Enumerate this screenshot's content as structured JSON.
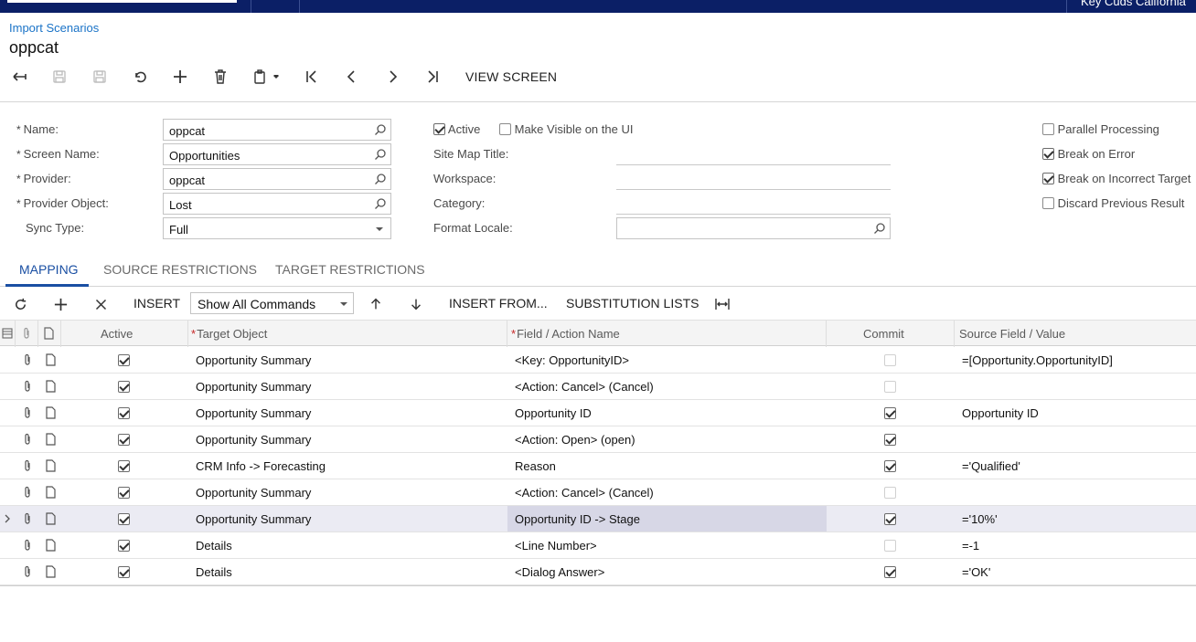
{
  "topbar": {
    "company": "Key Cuds California"
  },
  "breadcrumb": "Import Scenarios",
  "page_title": "oppcat",
  "toolbar": {
    "view_screen": "VIEW SCREEN",
    "icons": [
      "back-icon",
      "save-close-icon",
      "save-icon",
      "undo-icon",
      "add-icon",
      "delete-icon",
      "clipboard-icon",
      "first-icon",
      "previous-icon",
      "next-icon",
      "last-icon"
    ]
  },
  "form": {
    "name_label": "Name:",
    "name_value": "oppcat",
    "screen_name_label": "Screen Name:",
    "screen_name_value": "Opportunities",
    "provider_label": "Provider:",
    "provider_value": "oppcat",
    "provider_object_label": "Provider Object:",
    "provider_object_value": "Lost",
    "sync_type_label": "Sync Type:",
    "sync_type_value": "Full",
    "active_label": "Active",
    "active_checked": true,
    "make_visible_label": "Make Visible on the UI",
    "make_visible_checked": false,
    "site_map_title_label": "Site Map Title:",
    "workspace_label": "Workspace:",
    "category_label": "Category:",
    "format_locale_label": "Format Locale:",
    "parallel_processing_label": "Parallel Processing",
    "parallel_processing_checked": false,
    "break_on_error_label": "Break on Error",
    "break_on_error_checked": true,
    "break_on_incorrect_target_label": "Break on Incorrect Target",
    "break_on_incorrect_target_checked": true,
    "discard_previous_result_label": "Discard Previous Result",
    "discard_previous_result_checked": false
  },
  "tabs": [
    {
      "label": "MAPPING",
      "active": true
    },
    {
      "label": "SOURCE RESTRICTIONS",
      "active": false
    },
    {
      "label": "TARGET RESTRICTIONS",
      "active": false
    }
  ],
  "grid_toolbar": {
    "insert": "INSERT",
    "command_filter": "Show All Commands",
    "insert_from": "INSERT FROM...",
    "substitution_lists": "SUBSTITUTION LISTS"
  },
  "grid": {
    "columns": {
      "active": "Active",
      "target_object": "Target Object",
      "field_action_name": "Field / Action Name",
      "commit": "Commit",
      "source_field_value": "Source Field / Value"
    },
    "rows": [
      {
        "active": true,
        "target_object": "Opportunity Summary",
        "field": "<Key: OpportunityID>",
        "commit": false,
        "source": "=[Opportunity.OpportunityID]"
      },
      {
        "active": true,
        "target_object": "Opportunity Summary",
        "field": "<Action: Cancel> (Cancel)",
        "commit": false,
        "source": ""
      },
      {
        "active": true,
        "target_object": "Opportunity Summary",
        "field": "Opportunity ID",
        "commit": true,
        "source": "Opportunity ID"
      },
      {
        "active": true,
        "target_object": "Opportunity Summary",
        "field": "<Action: Open> (open)",
        "commit": true,
        "source": ""
      },
      {
        "active": true,
        "target_object": "CRM Info -> Forecasting",
        "field": "Reason",
        "commit": true,
        "source": "='Qualified'"
      },
      {
        "active": true,
        "target_object": "Opportunity Summary",
        "field": "<Action: Cancel> (Cancel)",
        "commit": false,
        "source": ""
      },
      {
        "active": true,
        "target_object": "Opportunity Summary",
        "field": "Opportunity ID -> Stage",
        "commit": true,
        "source": "='10%'",
        "selected": true
      },
      {
        "active": true,
        "target_object": "Details",
        "field": "<Line Number>",
        "commit": false,
        "source": "=-1"
      },
      {
        "active": true,
        "target_object": "Details",
        "field": "<Dialog Answer>",
        "commit": true,
        "source": "='OK'"
      }
    ]
  }
}
